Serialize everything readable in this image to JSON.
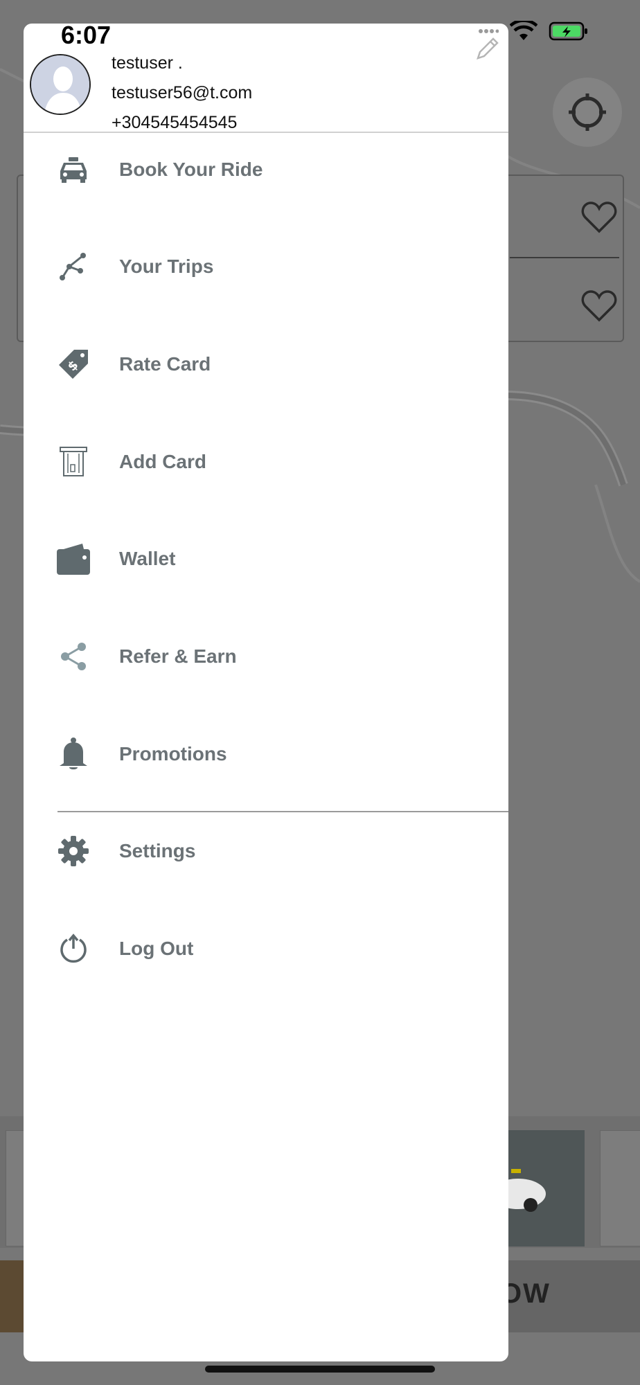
{
  "status_bar": {
    "time": "6:07"
  },
  "user": {
    "name": "testuser .",
    "email": "testuser56@t.com",
    "phone": "+304545454545"
  },
  "menu": {
    "items": [
      {
        "label": "Book Your Ride",
        "icon": "taxi-icon"
      },
      {
        "label": "Your Trips",
        "icon": "route-icon"
      },
      {
        "label": "Rate Card",
        "icon": "price-tag-icon"
      },
      {
        "label": "Add Card",
        "icon": "card-icon"
      },
      {
        "label": "Wallet",
        "icon": "wallet-icon"
      },
      {
        "label": "Refer & Earn",
        "icon": "share-icon"
      },
      {
        "label": "Promotions",
        "icon": "bell-icon"
      }
    ],
    "secondary_items": [
      {
        "label": "Settings",
        "icon": "gear-icon"
      },
      {
        "label": "Log Out",
        "icon": "power-icon"
      }
    ]
  },
  "background": {
    "confirm_button_fragment": "OW"
  },
  "colors": {
    "menu_label": "#6b7276",
    "menu_icon": "#5f6a6e",
    "battery_green": "#4cd964",
    "overlay": "#777777"
  }
}
